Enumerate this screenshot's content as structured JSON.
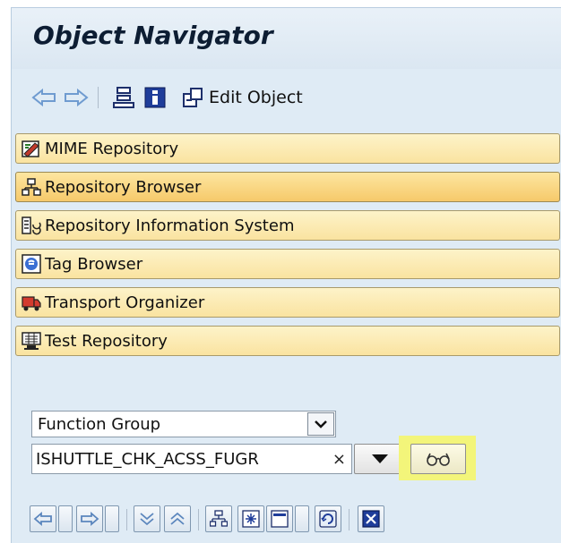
{
  "window": {
    "title": "Object Navigator"
  },
  "toolbar": {
    "edit_object_label": "Edit Object"
  },
  "nav_items": [
    {
      "label": "MIME Repository",
      "icon": "mime-repository-icon",
      "active": false
    },
    {
      "label": "Repository Browser",
      "icon": "repository-browser-icon",
      "active": true
    },
    {
      "label": "Repository Information System",
      "icon": "repository-information-system-icon",
      "active": false
    },
    {
      "label": "Tag Browser",
      "icon": "tag-browser-icon",
      "active": false
    },
    {
      "label": "Transport Organizer",
      "icon": "transport-organizer-icon",
      "active": false
    },
    {
      "label": "Test Repository",
      "icon": "test-repository-icon",
      "active": false
    }
  ],
  "object_type_select": {
    "value": "Function Group"
  },
  "object_name_input": {
    "value": "ISHUTTLE_CHK_ACSS_FUGR",
    "clear_symbol": "×"
  },
  "colors": {
    "window_bg": "#dfebf5",
    "nav_item_bg": "#fae3a0",
    "nav_item_active_bg": "#f6c96a",
    "highlight": "#f3f57a"
  }
}
